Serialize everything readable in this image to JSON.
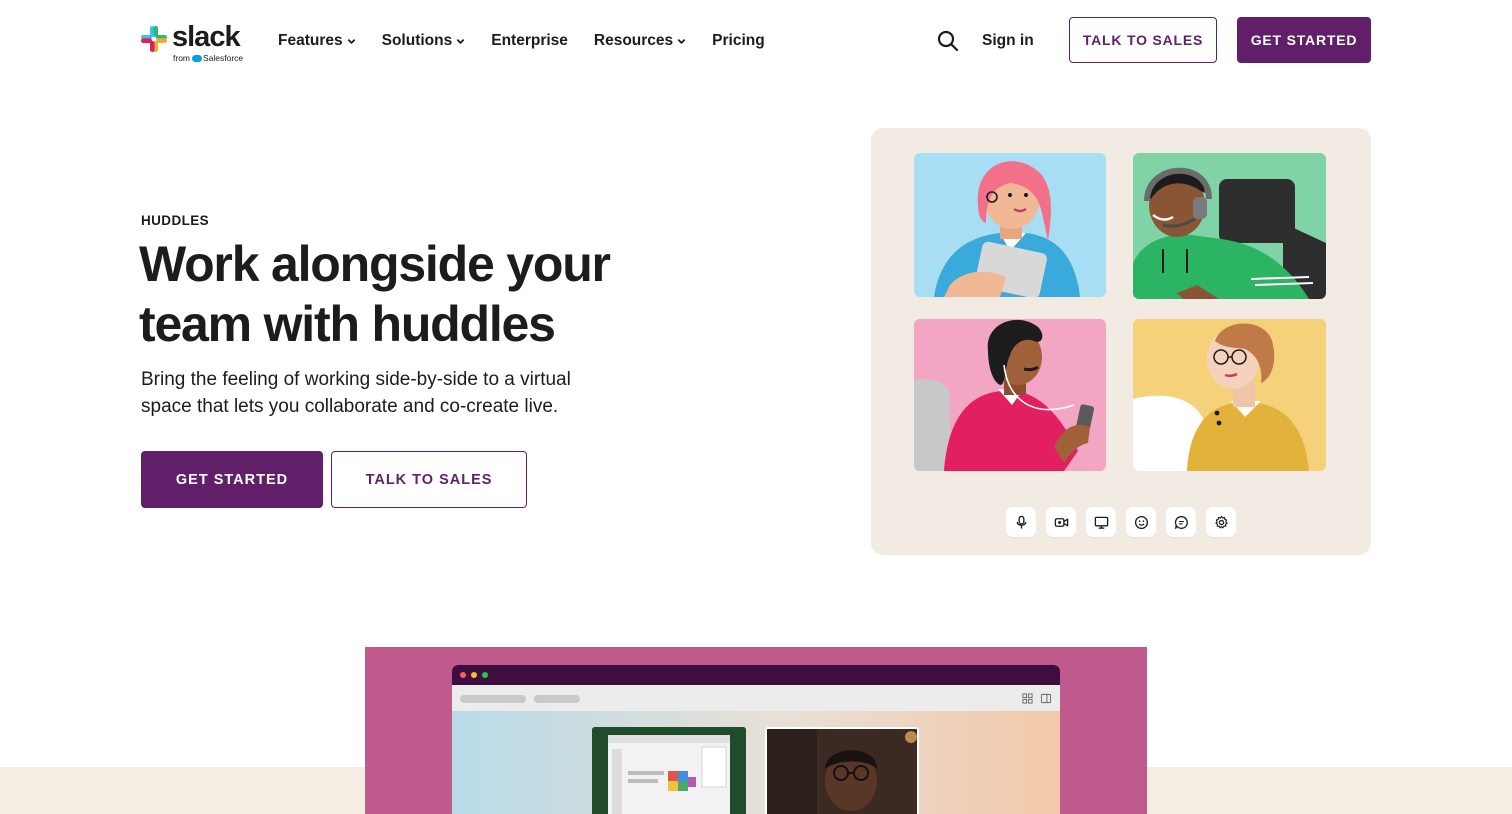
{
  "brand": {
    "wordmark": "slack",
    "sub_prefix": "from",
    "sub_company": "Salesforce",
    "colors": {
      "aubergine": "#611f69",
      "blue": "#36c5f0",
      "green": "#2eb67d",
      "yellow": "#ecb22e",
      "red": "#e01e5a"
    }
  },
  "header": {
    "nav": [
      {
        "label": "Features",
        "has_dropdown": true
      },
      {
        "label": "Solutions",
        "has_dropdown": true
      },
      {
        "label": "Enterprise",
        "has_dropdown": false
      },
      {
        "label": "Resources",
        "has_dropdown": true
      },
      {
        "label": "Pricing",
        "has_dropdown": false
      }
    ],
    "search_icon": "search-icon",
    "signin_label": "Sign in",
    "talk_to_sales_label": "TALK TO SALES",
    "get_started_label": "GET STARTED"
  },
  "hero": {
    "eyebrow": "HUDDLES",
    "headline_line1": "Work alongside your",
    "headline_line2": "team with huddles",
    "subhead": "Bring the feeling of working side-by-side to a virtual space that lets you collaborate and co-create live.",
    "primary_cta": "GET STARTED",
    "secondary_cta": "TALK TO SALES"
  },
  "illustration": {
    "background": "#f2ebe3",
    "tiles": [
      {
        "name": "participant-pink-hair",
        "background": "#a8def3"
      },
      {
        "name": "participant-headset",
        "background": "#7fd3a6"
      },
      {
        "name": "participant-earphones",
        "background": "#f3a6c4"
      },
      {
        "name": "participant-glasses",
        "background": "#f5d27a"
      }
    ],
    "controls": [
      "microphone-icon",
      "video-camera-icon",
      "screen-share-icon",
      "emoji-icon",
      "chat-icon",
      "settings-icon"
    ]
  },
  "lower_section": {
    "panel_color": "#c05a8d",
    "band_color": "#f4ede4",
    "window_titlebar_color": "#3f0e40"
  }
}
